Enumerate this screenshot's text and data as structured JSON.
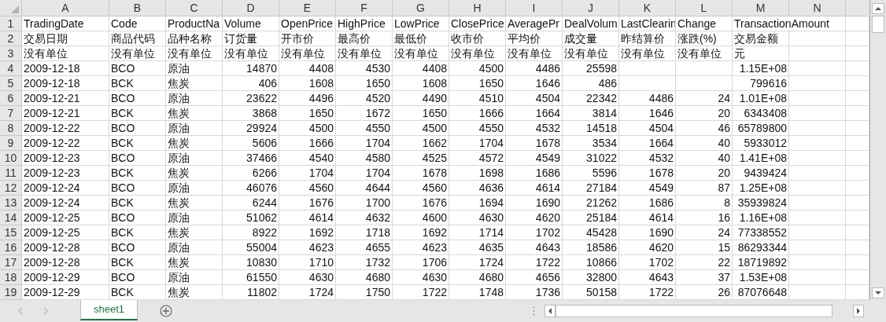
{
  "columns": [
    "A",
    "B",
    "C",
    "D",
    "E",
    "F",
    "G",
    "H",
    "I",
    "J",
    "K",
    "L",
    "M",
    "N"
  ],
  "rows": [
    {
      "number": "1",
      "kind": "header",
      "cells": {
        "A": "TradingDate",
        "B": "Code",
        "C": "ProductNa",
        "D": "Volume",
        "E": "OpenPrice",
        "F": "HighPrice",
        "G": "LowPrice",
        "H": "ClosePrice",
        "I": "AveragePr",
        "J": "DealVolum",
        "K": "LastClearin",
        "L": "Change",
        "M": "TransactionAmount"
      }
    },
    {
      "number": "2",
      "kind": "header",
      "cells": {
        "A": "交易日期",
        "B": "商品代码",
        "C": "品种名称",
        "D": "订货量",
        "E": "开市价",
        "F": "最高价",
        "G": "最低价",
        "H": "收市价",
        "I": "平均价",
        "J": "成交量",
        "K": "昨结算价",
        "L": "涨跌(%)",
        "M": "交易金额"
      }
    },
    {
      "number": "3",
      "kind": "header",
      "cells": {
        "A": "没有单位",
        "B": "没有单位",
        "C": "没有单位",
        "D": "没有单位",
        "E": "没有单位",
        "F": "没有单位",
        "G": "没有单位",
        "H": "没有单位",
        "I": "没有单位",
        "J": "没有单位",
        "K": "没有单位",
        "L": "没有单位",
        "M": "元"
      }
    },
    {
      "number": "4",
      "kind": "data",
      "cells": {
        "A": "2009-12-18",
        "B": "BCO",
        "C": "原油",
        "D": "14870",
        "E": "4408",
        "F": "4530",
        "G": "4408",
        "H": "4500",
        "I": "4486",
        "J": "25598",
        "M": "1.15E+08"
      }
    },
    {
      "number": "5",
      "kind": "data",
      "cells": {
        "A": "2009-12-18",
        "B": "BCK",
        "C": "焦炭",
        "D": "406",
        "E": "1608",
        "F": "1650",
        "G": "1608",
        "H": "1650",
        "I": "1646",
        "J": "486",
        "M": "799616"
      }
    },
    {
      "number": "6",
      "kind": "data",
      "cells": {
        "A": "2009-12-21",
        "B": "BCO",
        "C": "原油",
        "D": "23622",
        "E": "4496",
        "F": "4520",
        "G": "4490",
        "H": "4510",
        "I": "4504",
        "J": "22342",
        "K": "4486",
        "L": "24",
        "M": "1.01E+08"
      }
    },
    {
      "number": "7",
      "kind": "data",
      "cells": {
        "A": "2009-12-21",
        "B": "BCK",
        "C": "焦炭",
        "D": "3868",
        "E": "1650",
        "F": "1672",
        "G": "1650",
        "H": "1666",
        "I": "1664",
        "J": "3814",
        "K": "1646",
        "L": "20",
        "M": "6343408"
      }
    },
    {
      "number": "8",
      "kind": "data",
      "cells": {
        "A": "2009-12-22",
        "B": "BCO",
        "C": "原油",
        "D": "29924",
        "E": "4500",
        "F": "4550",
        "G": "4500",
        "H": "4550",
        "I": "4532",
        "J": "14518",
        "K": "4504",
        "L": "46",
        "M": "65789800"
      }
    },
    {
      "number": "9",
      "kind": "data",
      "cells": {
        "A": "2009-12-22",
        "B": "BCK",
        "C": "焦炭",
        "D": "5606",
        "E": "1666",
        "F": "1704",
        "G": "1662",
        "H": "1704",
        "I": "1678",
        "J": "3534",
        "K": "1664",
        "L": "40",
        "M": "5933012"
      }
    },
    {
      "number": "10",
      "kind": "data",
      "cells": {
        "A": "2009-12-23",
        "B": "BCO",
        "C": "原油",
        "D": "37466",
        "E": "4540",
        "F": "4580",
        "G": "4525",
        "H": "4572",
        "I": "4549",
        "J": "31022",
        "K": "4532",
        "L": "40",
        "M": "1.41E+08"
      }
    },
    {
      "number": "11",
      "kind": "data",
      "cells": {
        "A": "2009-12-23",
        "B": "BCK",
        "C": "焦炭",
        "D": "6266",
        "E": "1704",
        "F": "1704",
        "G": "1678",
        "H": "1698",
        "I": "1686",
        "J": "5596",
        "K": "1678",
        "L": "20",
        "M": "9439424"
      }
    },
    {
      "number": "12",
      "kind": "data",
      "cells": {
        "A": "2009-12-24",
        "B": "BCO",
        "C": "原油",
        "D": "46076",
        "E": "4560",
        "F": "4644",
        "G": "4560",
        "H": "4636",
        "I": "4614",
        "J": "27184",
        "K": "4549",
        "L": "87",
        "M": "1.25E+08"
      }
    },
    {
      "number": "13",
      "kind": "data",
      "cells": {
        "A": "2009-12-24",
        "B": "BCK",
        "C": "焦炭",
        "D": "6244",
        "E": "1676",
        "F": "1700",
        "G": "1676",
        "H": "1694",
        "I": "1690",
        "J": "21262",
        "K": "1686",
        "L": "8",
        "M": "35939824"
      }
    },
    {
      "number": "14",
      "kind": "data",
      "cells": {
        "A": "2009-12-25",
        "B": "BCO",
        "C": "原油",
        "D": "51062",
        "E": "4614",
        "F": "4632",
        "G": "4600",
        "H": "4630",
        "I": "4620",
        "J": "25184",
        "K": "4614",
        "L": "16",
        "M": "1.16E+08"
      }
    },
    {
      "number": "15",
      "kind": "data",
      "cells": {
        "A": "2009-12-25",
        "B": "BCK",
        "C": "焦炭",
        "D": "8922",
        "E": "1692",
        "F": "1718",
        "G": "1692",
        "H": "1714",
        "I": "1702",
        "J": "45428",
        "K": "1690",
        "L": "24",
        "M": "77338552"
      }
    },
    {
      "number": "16",
      "kind": "data",
      "cells": {
        "A": "2009-12-28",
        "B": "BCO",
        "C": "原油",
        "D": "55004",
        "E": "4623",
        "F": "4655",
        "G": "4623",
        "H": "4635",
        "I": "4643",
        "J": "18586",
        "K": "4620",
        "L": "15",
        "M": "86293344"
      }
    },
    {
      "number": "17",
      "kind": "data",
      "cells": {
        "A": "2009-12-28",
        "B": "BCK",
        "C": "焦炭",
        "D": "10830",
        "E": "1710",
        "F": "1732",
        "G": "1706",
        "H": "1724",
        "I": "1722",
        "J": "10866",
        "K": "1702",
        "L": "22",
        "M": "18719892"
      }
    },
    {
      "number": "18",
      "kind": "data",
      "cells": {
        "A": "2009-12-29",
        "B": "BCO",
        "C": "原油",
        "D": "61550",
        "E": "4630",
        "F": "4680",
        "G": "4630",
        "H": "4680",
        "I": "4656",
        "J": "32800",
        "K": "4643",
        "L": "37",
        "M": "1.53E+08"
      }
    },
    {
      "number": "19",
      "kind": "data",
      "cells": {
        "A": "2009-12-29",
        "B": "BCK",
        "C": "焦炭",
        "D": "11802",
        "E": "1724",
        "F": "1750",
        "G": "1722",
        "H": "1748",
        "I": "1736",
        "J": "50158",
        "K": "1722",
        "L": "26",
        "M": "87076648"
      }
    }
  ],
  "sheet_tabs": [
    {
      "label": "sheet1",
      "selected": true
    }
  ]
}
